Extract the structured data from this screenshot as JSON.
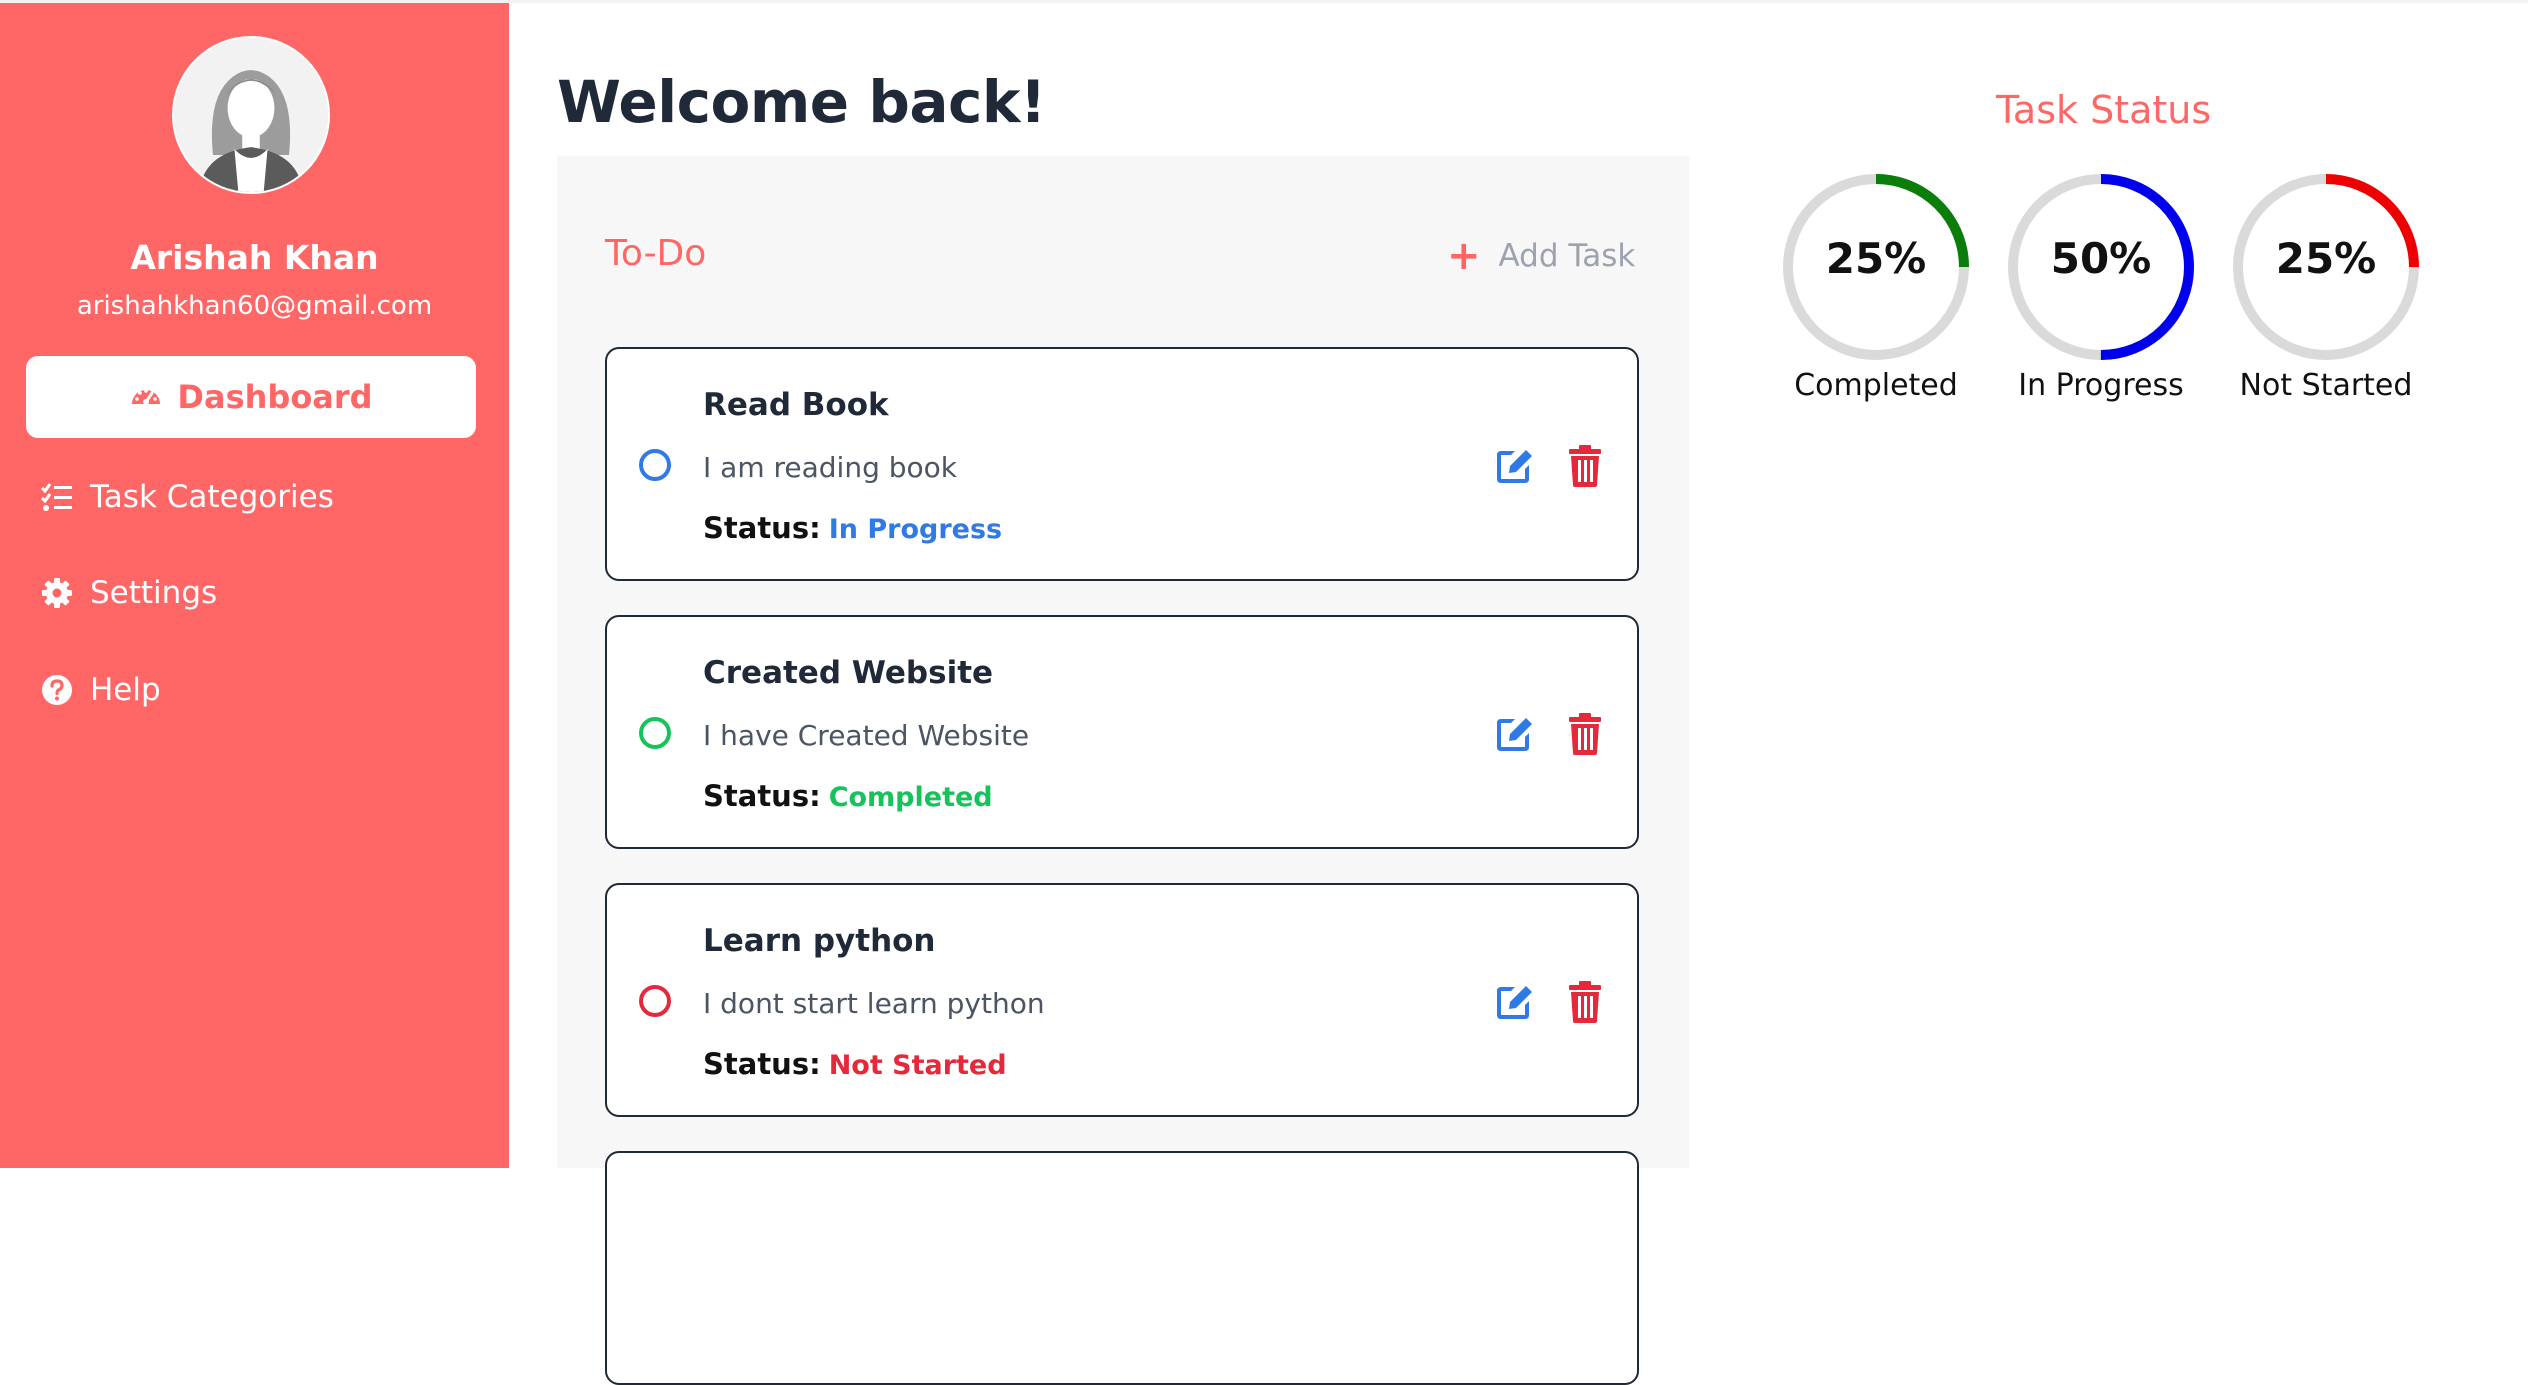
{
  "user": {
    "name": "Arishah Khan",
    "email": "arishahkhan60@gmail.com"
  },
  "sidebar": {
    "items": [
      {
        "label": "Dashboard",
        "icon": "dashboard-gauge-icon",
        "active": true
      },
      {
        "label": "Task Categories",
        "icon": "list-check-icon",
        "active": false
      },
      {
        "label": "Settings",
        "icon": "gear-icon",
        "active": false
      },
      {
        "label": "Help",
        "icon": "question-circle-icon",
        "active": false
      }
    ]
  },
  "main": {
    "welcome": "Welcome back!",
    "todo": {
      "title": "To-Do",
      "add_task_label": "Add Task",
      "status_prefix": "Status:",
      "tasks": [
        {
          "title": "Read Book",
          "description": "I am reading book",
          "status": "In Progress",
          "status_color": "#2f7ae5"
        },
        {
          "title": "Created Website",
          "description": "I have Created Website",
          "status": "Completed",
          "status_color": "#16c25a"
        },
        {
          "title": "Learn python",
          "description": "I dont start learn python",
          "status": "Not Started",
          "status_color": "#e5283a"
        }
      ]
    }
  },
  "task_status": {
    "title": "Task Status",
    "items": [
      {
        "label": "Completed",
        "percent": "25%",
        "value": 25,
        "color": "#0a7d0a"
      },
      {
        "label": "In Progress",
        "percent": "50%",
        "value": 50,
        "color": "#0000ee"
      },
      {
        "label": "Not Started",
        "percent": "25%",
        "value": 25,
        "color": "#ee0000"
      }
    ]
  },
  "colors": {
    "accent": "#ff6766",
    "edit": "#2f7ae5",
    "delete": "#e5283a"
  }
}
